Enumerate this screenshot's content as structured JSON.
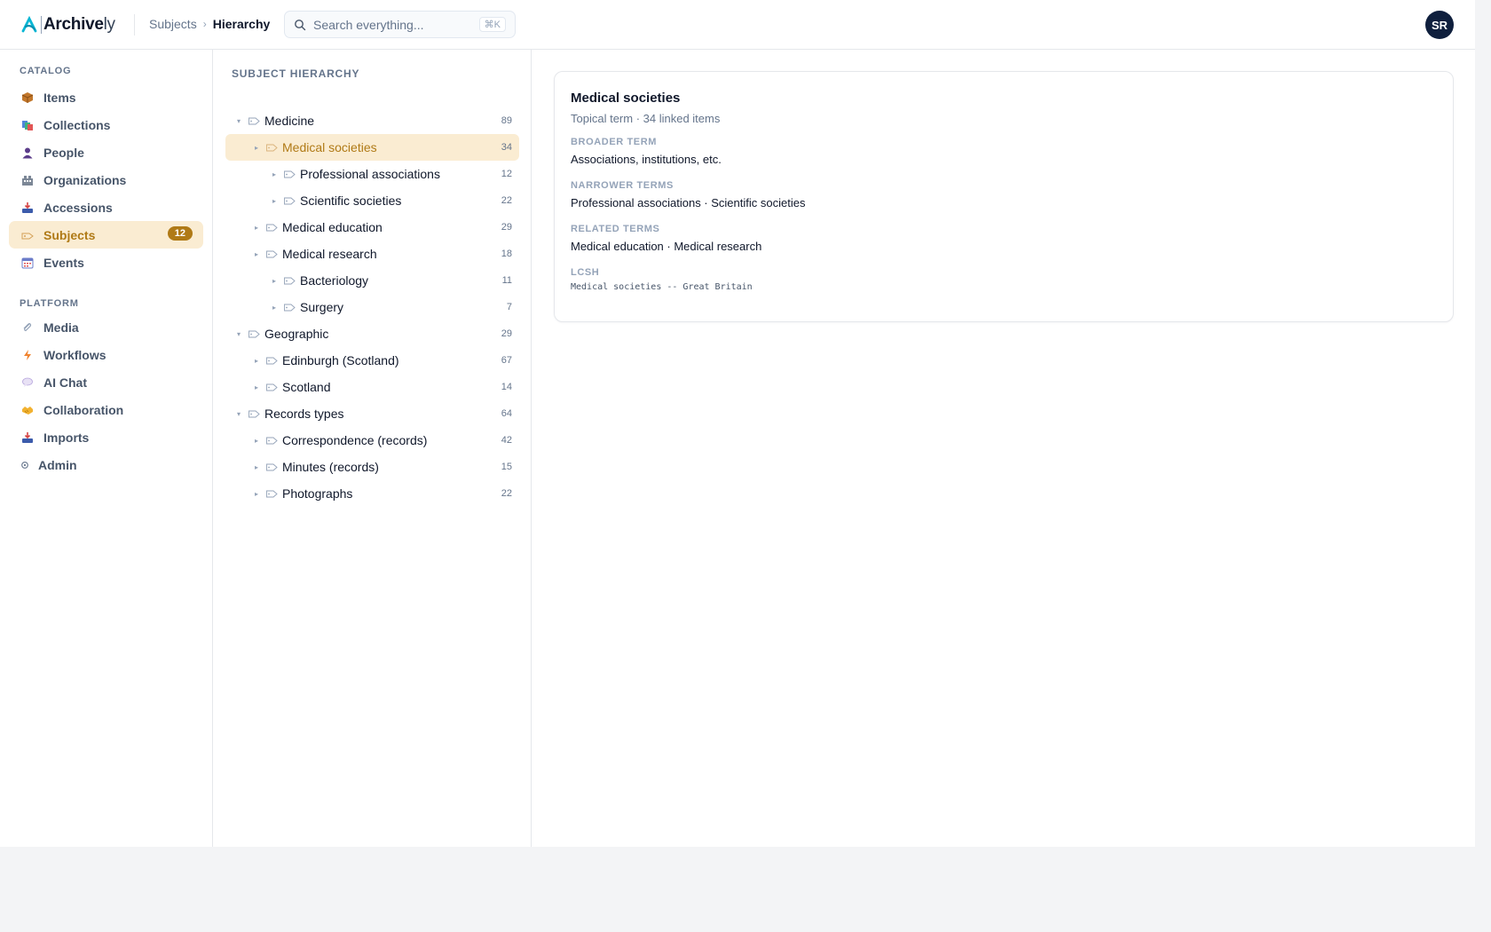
{
  "app": {
    "brand": "Archive",
    "brand_suffix": "ly",
    "avatar_initials": "SR"
  },
  "breadcrumb": {
    "parent": "Subjects",
    "separator": "›",
    "current": "Hierarchy"
  },
  "search": {
    "placeholder": "Search everything...",
    "shortcut": "⌘K"
  },
  "sidebar": {
    "catalog_label": "CATALOG",
    "catalog_items": [
      {
        "label": "Items",
        "icon": "box-icon"
      },
      {
        "label": "Collections",
        "icon": "collections-icon"
      },
      {
        "label": "People",
        "icon": "person-icon"
      },
      {
        "label": "Organizations",
        "icon": "building-icon"
      },
      {
        "label": "Accessions",
        "icon": "inbox-icon"
      },
      {
        "label": "Subjects",
        "icon": "tag-icon",
        "badge": "12",
        "active": true
      },
      {
        "label": "Events",
        "icon": "calendar-icon"
      }
    ],
    "platform_label": "PLATFORM",
    "platform_items": [
      {
        "label": "Media",
        "icon": "paperclip-icon"
      },
      {
        "label": "Workflows",
        "icon": "lightning-icon"
      },
      {
        "label": "AI Chat",
        "icon": "chat-bubble-icon"
      },
      {
        "label": "Collaboration",
        "icon": "handshake-icon"
      },
      {
        "label": "Imports",
        "icon": "import-tray-icon"
      },
      {
        "label": "Admin",
        "icon": "gear-icon"
      }
    ]
  },
  "tree": {
    "heading": "SUBJECT HIERARCHY",
    "rows": [
      {
        "label": "Medicine",
        "count": "89",
        "level": 0,
        "expanded": true
      },
      {
        "label": "Medical societies",
        "count": "34",
        "level": 1,
        "selected": true
      },
      {
        "label": "Professional associations",
        "count": "12",
        "level": 2
      },
      {
        "label": "Scientific societies",
        "count": "22",
        "level": 2
      },
      {
        "label": "Medical education",
        "count": "29",
        "level": 1
      },
      {
        "label": "Medical research",
        "count": "18",
        "level": 1
      },
      {
        "label": "Bacteriology",
        "count": "11",
        "level": 2
      },
      {
        "label": "Surgery",
        "count": "7",
        "level": 2
      },
      {
        "label": "Geographic",
        "count": "29",
        "level": 0,
        "expanded": true
      },
      {
        "label": "Edinburgh (Scotland)",
        "count": "67",
        "level": 1
      },
      {
        "label": "Scotland",
        "count": "14",
        "level": 1
      },
      {
        "label": "Records types",
        "count": "64",
        "level": 0,
        "expanded": true
      },
      {
        "label": "Correspondence (records)",
        "count": "42",
        "level": 1
      },
      {
        "label": "Minutes (records)",
        "count": "15",
        "level": 1
      },
      {
        "label": "Photographs",
        "count": "22",
        "level": 1
      }
    ]
  },
  "detail": {
    "title": "Medical societies",
    "subtitle": "Topical term · 34 linked items",
    "broader_label": "BROADER TERM",
    "broader_value": "Associations, institutions, etc.",
    "narrower_label": "NARROWER TERMS",
    "narrower_value": "Professional associations · Scientific societies",
    "related_label": "RELATED TERMS",
    "related_value": "Medical education · Medical research",
    "lcsh_label": "LCSH",
    "lcsh_value": "Medical societies -- Great Britain"
  },
  "colors": {
    "accent": "#b07a16",
    "accent_bg": "#faecd2",
    "brand_mark": "#06b6d4",
    "avatar_bg": "#0f1f3d"
  }
}
